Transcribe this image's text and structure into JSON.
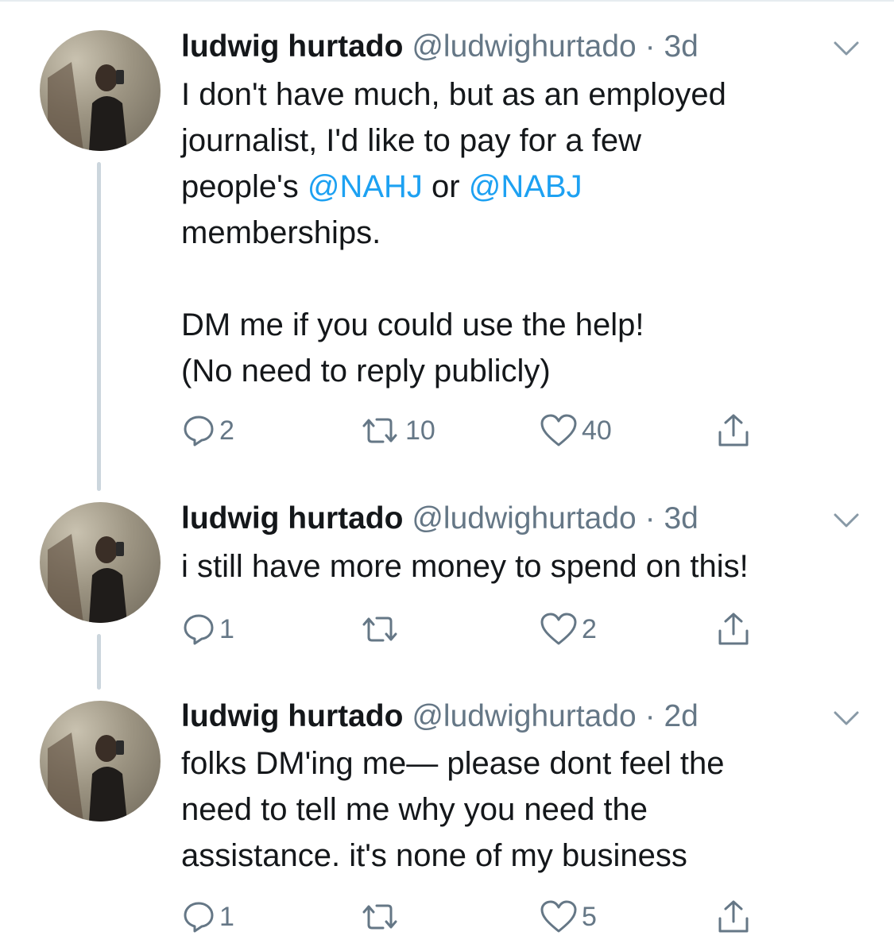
{
  "tweets": [
    {
      "name": "ludwig hurtado",
      "handle": "@ludwighurtado",
      "dot": "·",
      "time": "3d",
      "text_parts": [
        "I don't have much, but as an employed\njournalist, I'd like to pay for a few\npeople's ",
        "@NAHJ",
        " or ",
        "@NABJ",
        "\nmemberships.\n\nDM me if you could use the help!\n(No need to reply publicly)"
      ],
      "replies": "2",
      "retweets": "10",
      "likes": "40"
    },
    {
      "name": "ludwig hurtado",
      "handle": "@ludwighurtado",
      "dot": "·",
      "time": "3d",
      "text": "i still have more money to spend on this!",
      "replies": "1",
      "retweets": "",
      "likes": "2"
    },
    {
      "name": "ludwig hurtado",
      "handle": "@ludwighurtado",
      "dot": "·",
      "time": "2d",
      "text": "folks DM'ing me— please dont feel the\nneed to tell me why you need the\nassistance. it's none of my business",
      "replies": "1",
      "retweets": "",
      "likes": "5"
    }
  ],
  "icons": [
    "avatar-photo",
    "chevron-down-icon",
    "reply-icon",
    "retweet-icon",
    "like-icon",
    "share-icon"
  ],
  "colors": {
    "text": "#14171a",
    "secondary": "#657786",
    "link": "#1da1f2",
    "thread": "#ccd6dd"
  }
}
